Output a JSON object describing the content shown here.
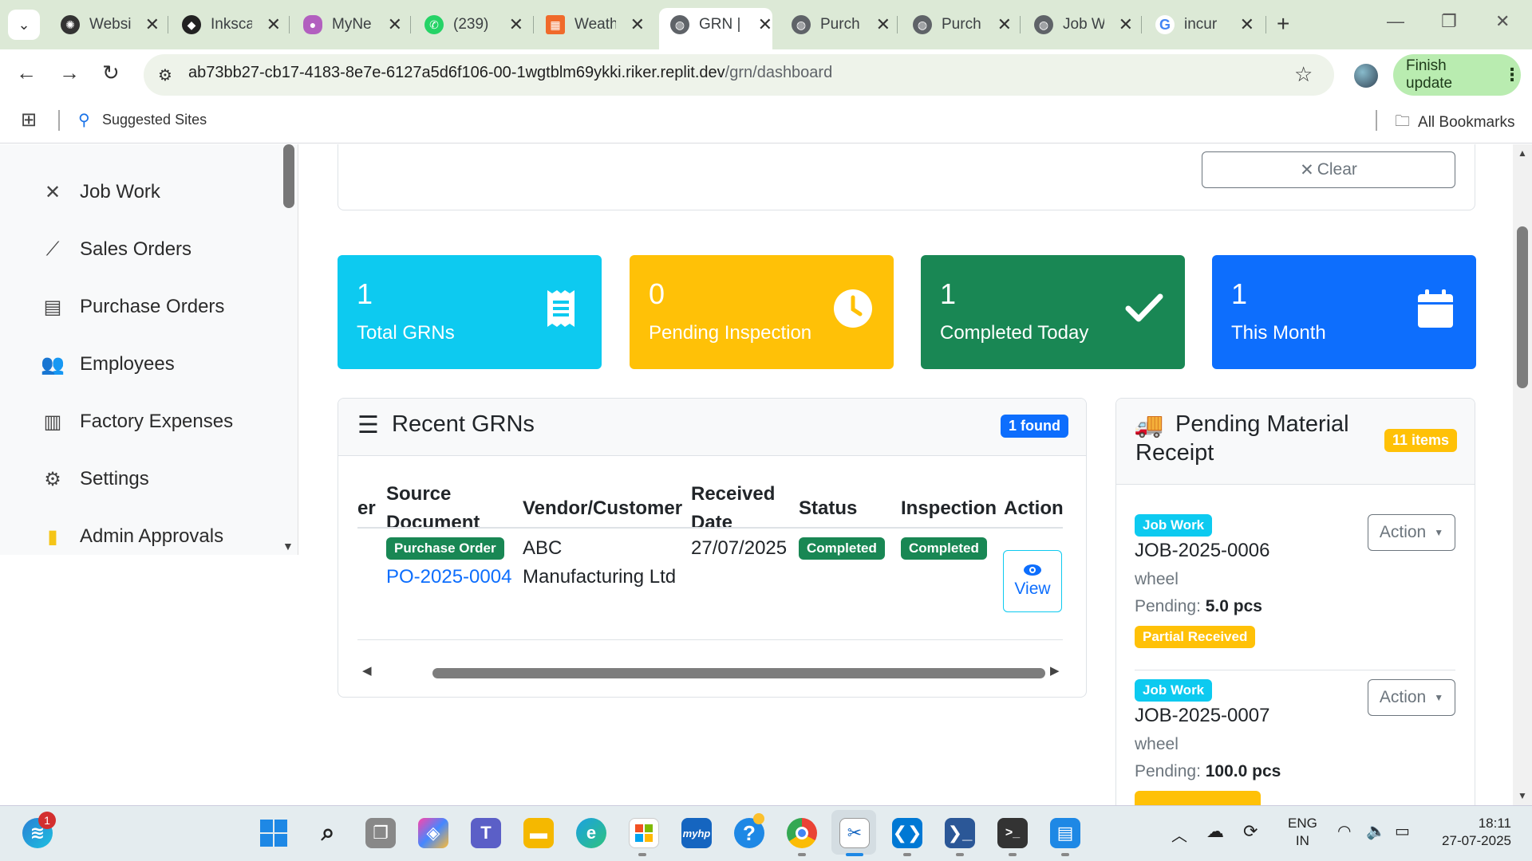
{
  "browser": {
    "tabs": [
      {
        "label": "Websi",
        "icon": "openai-icon",
        "color": "#333333"
      },
      {
        "label": "Inksca",
        "icon": "inkscape-icon",
        "color": "#222222"
      },
      {
        "label": "MyNe",
        "icon": "mynet-icon",
        "color": "#b25fbf"
      },
      {
        "label": "(239)",
        "icon": "whatsapp-icon",
        "color": "#25d366"
      },
      {
        "label": "Weath",
        "icon": "weather-icon",
        "color": "#f06a2b"
      },
      {
        "label": "GRN |",
        "icon": "globe-icon",
        "color": "#5f6368",
        "active": true
      },
      {
        "label": "Purch",
        "icon": "globe-icon",
        "color": "#5f6368"
      },
      {
        "label": "Purch",
        "icon": "globe-icon",
        "color": "#5f6368"
      },
      {
        "label": "Job W",
        "icon": "globe-icon",
        "color": "#5f6368"
      },
      {
        "label": "incur",
        "icon": "google-icon",
        "color": "#4285f4"
      }
    ],
    "url_main": "ab73bb27-cb17-4183-8e7e-6127a5d6f106-00-1wgtblm69ykki.riker.replit.dev",
    "url_path": "/grn/dashboard",
    "finish_update": "Finish update",
    "suggested_sites": "Suggested Sites",
    "all_bookmarks": "All Bookmarks"
  },
  "sidebar": {
    "items": [
      {
        "label": "Job Work",
        "icon": "tools-icon"
      },
      {
        "label": "Sales Orders",
        "icon": "chart-line-icon"
      },
      {
        "label": "Purchase Orders",
        "icon": "file-icon"
      },
      {
        "label": "Employees",
        "icon": "users-icon"
      },
      {
        "label": "Factory Expenses",
        "icon": "receipt-icon"
      },
      {
        "label": "Settings",
        "icon": "gear-icon"
      },
      {
        "label": "Admin Approvals",
        "icon": "clipboard-check-icon"
      }
    ]
  },
  "filters": {
    "clear_label": "Clear"
  },
  "stats": [
    {
      "value": "1",
      "label": "Total GRNs",
      "color": "#0dcaf0",
      "icon": "receipt-icon"
    },
    {
      "value": "0",
      "label": "Pending Inspection",
      "color": "#ffc107",
      "icon": "clock-icon"
    },
    {
      "value": "1",
      "label": "Completed Today",
      "color": "#198754",
      "icon": "check-icon"
    },
    {
      "value": "1",
      "label": "This Month",
      "color": "#0d6efd",
      "icon": "calendar-icon"
    }
  ],
  "recent": {
    "title": "Recent GRNs",
    "badge": "1 found",
    "columns": {
      "col0": "er",
      "source_line1": "Source",
      "source_line2": "Document",
      "vendor": "Vendor/Customer",
      "received_line1": "Received",
      "received_line2": "Date",
      "status": "Status",
      "inspection": "Inspection",
      "action": "Action"
    },
    "rows": [
      {
        "source_type": "Purchase Order",
        "source_number": "PO-2025-0004",
        "vendor_line1": "ABC",
        "vendor_line2": "Manufacturing Ltd",
        "received": "27/07/2025",
        "status": "Completed",
        "inspection": "Completed",
        "action": "View"
      }
    ]
  },
  "pending": {
    "title_line1": "Pending Material",
    "title_line2": "Receipt",
    "badge": "11 items",
    "items": [
      {
        "type": "Job Work",
        "number": "JOB-2025-0006",
        "item": "wheel",
        "pending_label": "Pending:",
        "pending_qty": "5.0 pcs",
        "status": "Partial Received",
        "action": "Action"
      },
      {
        "type": "Job Work",
        "number": "JOB-2025-0007",
        "item": "wheel",
        "pending_label": "Pending:",
        "pending_qty": "100.0 pcs",
        "action": "Action"
      }
    ]
  },
  "taskbar": {
    "notification_count": "1",
    "lang_line1": "ENG",
    "lang_line2": "IN",
    "time": "18:11",
    "date": "27-07-2025"
  }
}
